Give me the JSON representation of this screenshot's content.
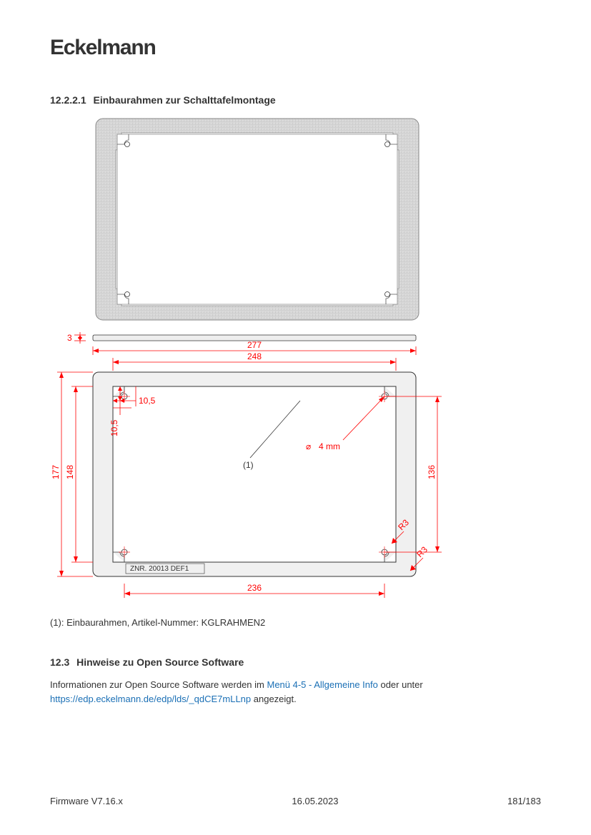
{
  "logo": "Eckelmann",
  "section1": {
    "number": "12.2.2.1",
    "title": "Einbaurahmen zur Schalttafelmontage"
  },
  "drawing": {
    "dims": {
      "thickness": "3",
      "outer_width": "277",
      "inner_width": "248",
      "hole_offset_x": "10,5",
      "hole_offset_y": "10,5",
      "outer_height": "177",
      "inner_height": "148",
      "right_height": "136",
      "bottom_width": "236",
      "radius_top": "R3",
      "radius_side": "R3",
      "hole_dia": "4 mm"
    },
    "label_ref": "(1)",
    "part_num": "ZNR. 20013 DEF1"
  },
  "caption": "(1): Einbaurahmen, Artikel-Nummer: KGLRAHMEN2",
  "section2": {
    "number": "12.3",
    "title": "Hinweise zu Open Source Software",
    "text_pre": "Informationen zur Open Source Software werden im ",
    "link1": "Menü 4-5 - Allgemeine Info",
    "text_mid": " oder unter ",
    "link2": "https://edp.eckelmann.de/edp/lds/_qdCE7mLLnp",
    "text_post": " angezeigt."
  },
  "footer": {
    "left": "Firmware V7.16.x",
    "center": "16.05.2023",
    "right": "181/183"
  }
}
